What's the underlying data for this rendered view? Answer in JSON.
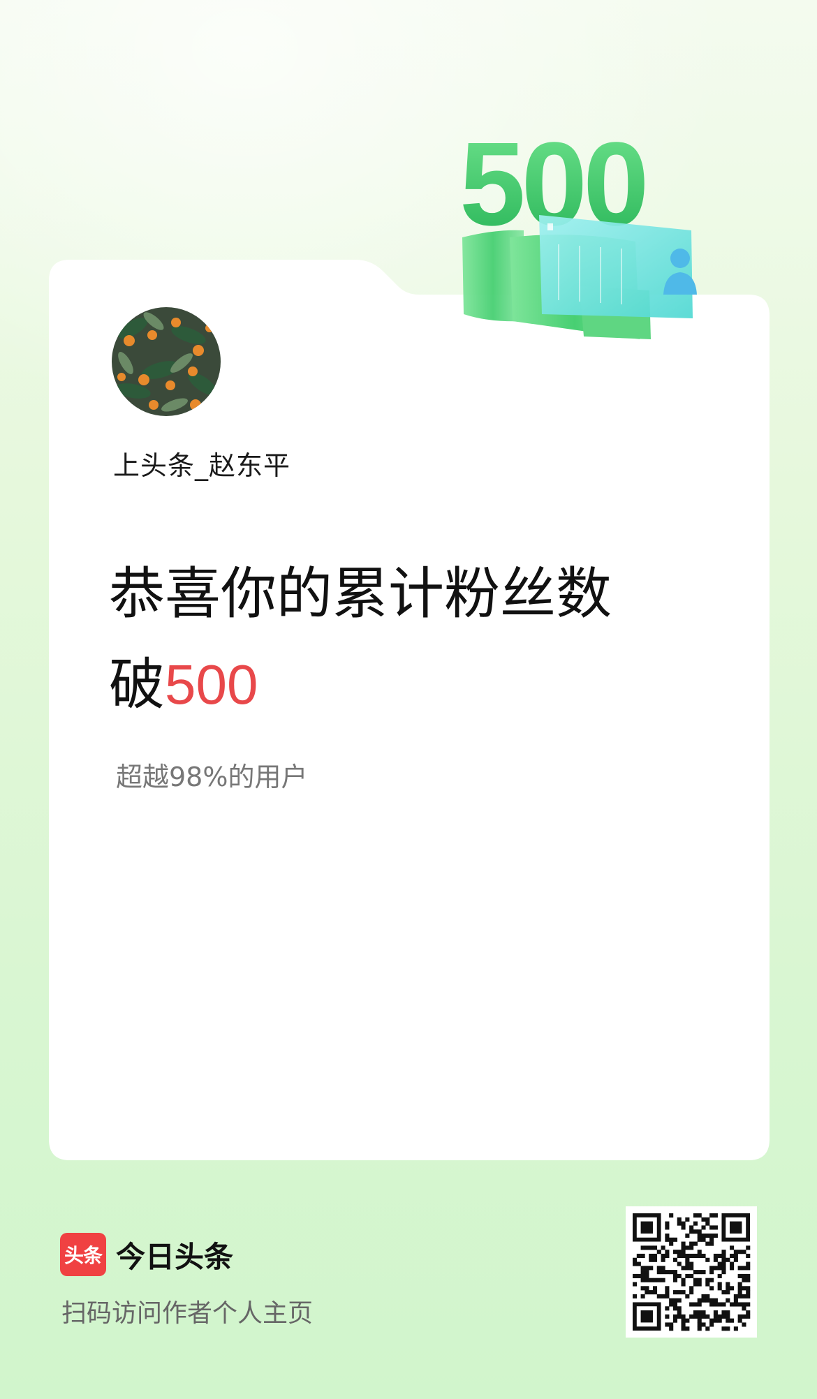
{
  "badge": {
    "number": "500"
  },
  "user": {
    "name": "上头条_赵东平"
  },
  "headline": {
    "line1": "恭喜你的累计粉丝数",
    "prefix": "破",
    "number": "500"
  },
  "subtext": "超越98%的用户",
  "brand": {
    "logo_text": "头条",
    "name": "今日头条",
    "scan_hint": "扫码访问作者个人主页"
  },
  "colors": {
    "accent_red": "#e8484a",
    "brand_red": "#f04142",
    "badge_green": "#3ecf6a",
    "background": "#d9f6d2"
  },
  "icons": [
    "user-icon",
    "qr-code"
  ]
}
